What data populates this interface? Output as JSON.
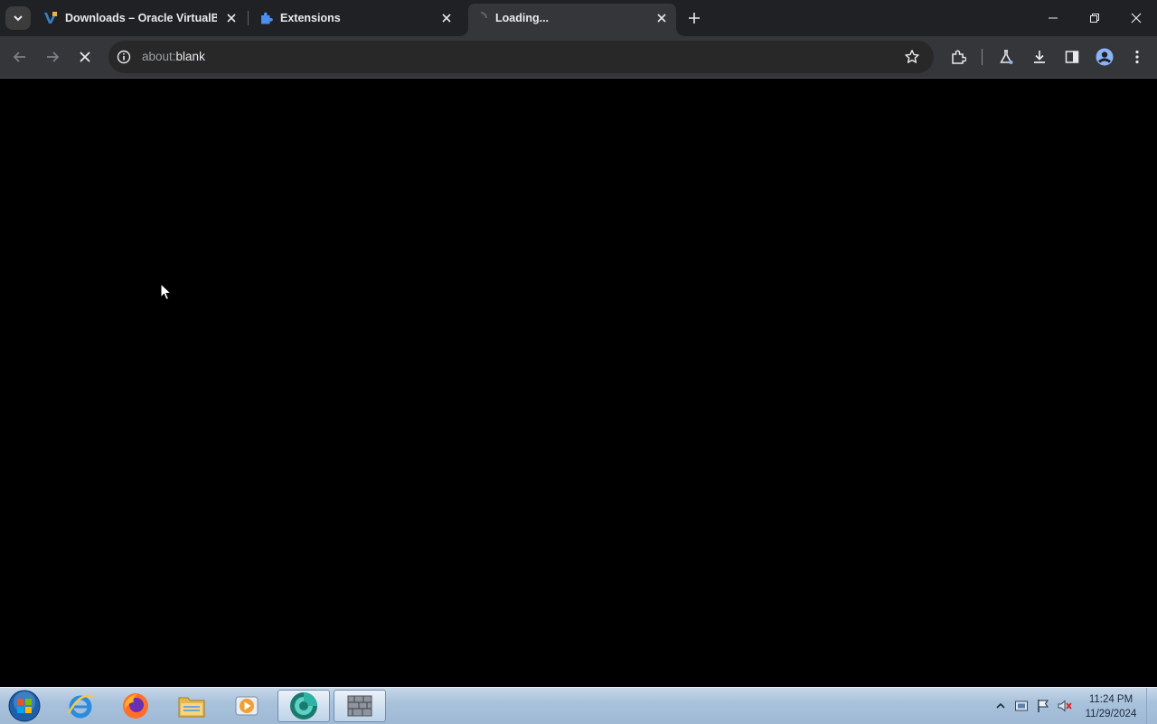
{
  "browser": {
    "tabs": [
      {
        "title": "Downloads – Oracle VirtualBox",
        "icon": "virtualbox-icon",
        "active": false
      },
      {
        "title": "Extensions",
        "icon": "puzzle-icon",
        "active": false
      },
      {
        "title": "Loading...",
        "icon": "loading-spinner-icon",
        "active": true
      }
    ],
    "new_tab_label": "+",
    "address": {
      "scheme": "about:",
      "rest": "blank"
    }
  },
  "taskbar": {
    "apps": [
      "start-orb-icon",
      "internet-explorer-icon",
      "firefox-icon",
      "file-explorer-icon",
      "media-player-icon",
      "chrome-beta-icon",
      "firewall-icon"
    ],
    "clock": {
      "time": "11:24 PM",
      "date": "11/29/2024"
    }
  },
  "colors": {
    "tab_strip": "#202124",
    "toolbar": "#35363a",
    "page": "#000000",
    "accent": "#8ab4f8"
  }
}
